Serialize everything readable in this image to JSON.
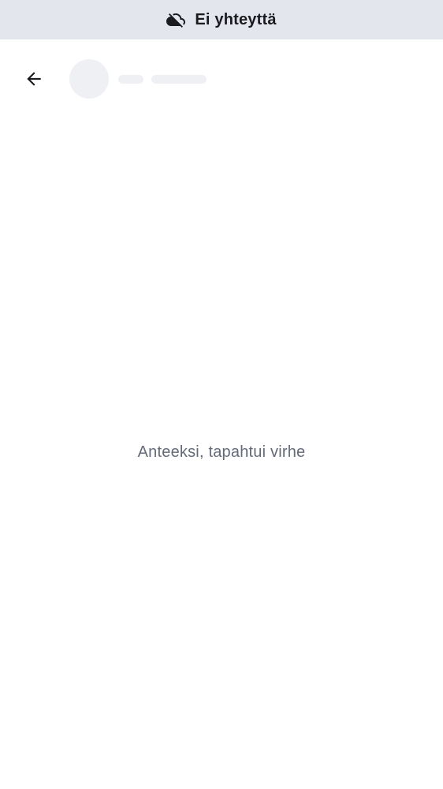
{
  "offline_banner": {
    "icon": "cloud-off-icon",
    "label": "Ei yhteyttä"
  },
  "header": {
    "back_icon": "arrow-left-icon",
    "avatar": "loading-placeholder",
    "title": "loading-placeholder"
  },
  "main": {
    "error_message": "Anteeksi, tapahtui virhe"
  },
  "colors": {
    "banner_background": "#e3e6ec",
    "skeleton": "#eef0f4",
    "error_text": "#646a78",
    "primary_text": "#1b1b1f"
  }
}
